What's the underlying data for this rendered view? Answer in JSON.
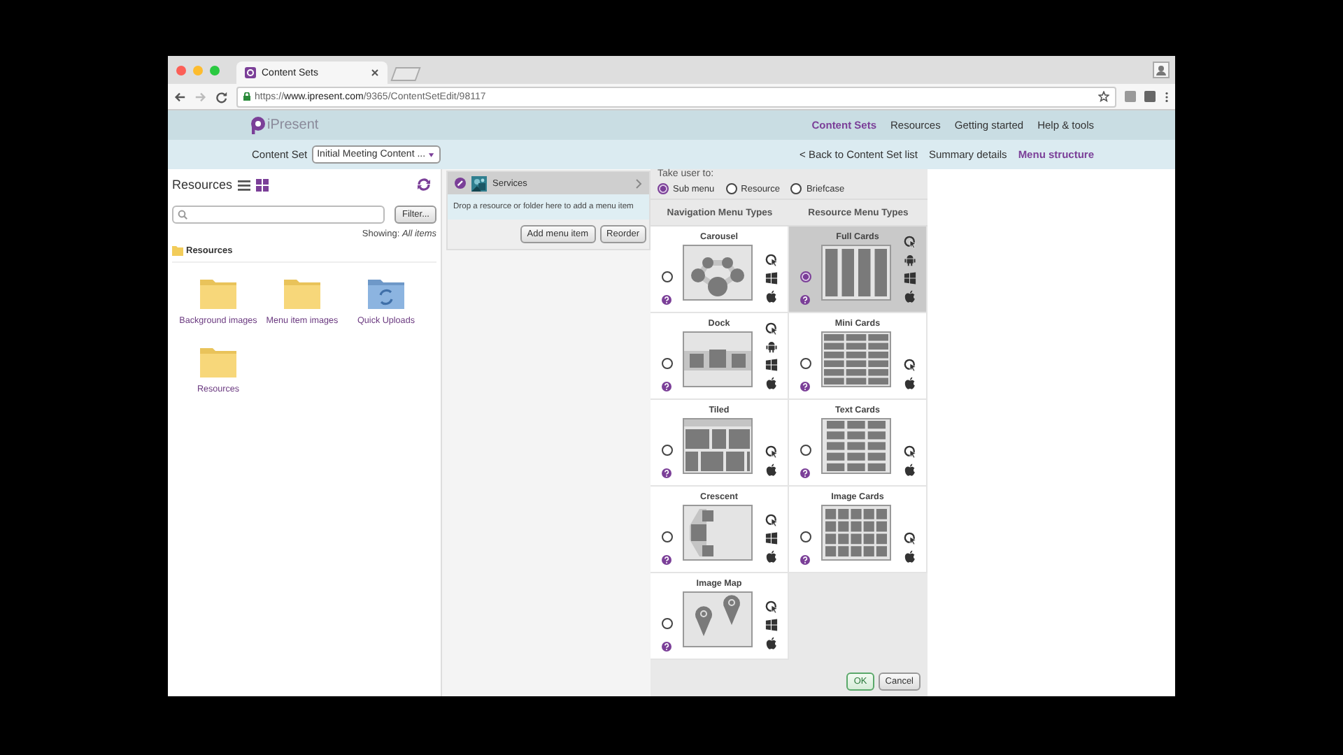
{
  "browser": {
    "tabs": [
      {
        "title": "Content Sets"
      }
    ],
    "url": "https://**www.ipresent.com**/9365/ContentSetEdit/98117"
  },
  "header": {
    "logo": "iPresent",
    "nav": [
      {
        "label": "Content Sets",
        "selected": true
      },
      {
        "label": "Resources",
        "selected": false
      },
      {
        "label": "Getting started",
        "selected": false
      },
      {
        "label": "Help & tools",
        "selected": false
      }
    ]
  },
  "subheader": {
    "label": "Content Set",
    "dropdown": "Initial Meeting Content ...",
    "links": [
      {
        "label": "< Back to Content Set list",
        "selected": false
      },
      {
        "label": "Summary details",
        "selected": false
      },
      {
        "label": "Menu structure",
        "selected": true
      }
    ]
  },
  "resources": {
    "title": "Resources",
    "views": [
      {
        "kind": "list",
        "selected": false
      },
      {
        "kind": "grid",
        "selected": true
      }
    ],
    "filter_button": "Filter...",
    "showing": "Showing: *All items*",
    "breadcrumb": "Resources",
    "items": [
      {
        "name": "Background images",
        "kind": "folder"
      },
      {
        "name": "Menu item images",
        "kind": "folder"
      },
      {
        "name": "Quick Uploads",
        "kind": "uploads"
      },
      {
        "name": "Resources",
        "kind": "folder"
      }
    ]
  },
  "menu": {
    "items": [
      {
        "label": "Services"
      }
    ],
    "drop_hint": "Drop a resource or folder here to add a menu item",
    "buttons": [
      "Add menu item",
      "Reorder"
    ]
  },
  "dialog": {
    "prompt": "Take user to:",
    "targets": [
      {
        "label": "Sub menu",
        "selected": true
      },
      {
        "label": "Resource",
        "selected": false
      },
      {
        "label": "Briefcase",
        "selected": false
      }
    ],
    "columns": [
      {
        "heading": "Navigation Menu Types",
        "types": [
          {
            "name": "Carousel",
            "kind": "carousel",
            "selected": false,
            "platforms": [
              {
                "kind": "web"
              },
              {
                "kind": "windows"
              },
              {
                "kind": "apple"
              }
            ]
          },
          {
            "name": "Dock",
            "kind": "dock",
            "selected": false,
            "platforms": [
              {
                "kind": "web"
              },
              {
                "kind": "android"
              },
              {
                "kind": "windows"
              },
              {
                "kind": "apple"
              }
            ]
          },
          {
            "name": "Tiled",
            "kind": "tiled",
            "selected": false,
            "platforms": [
              {
                "kind": "web"
              },
              {
                "kind": "apple"
              }
            ]
          },
          {
            "name": "Crescent",
            "kind": "crescent",
            "selected": false,
            "platforms": [
              {
                "kind": "web"
              },
              {
                "kind": "windows"
              },
              {
                "kind": "apple"
              }
            ]
          },
          {
            "name": "Image Map",
            "kind": "image_map",
            "selected": false,
            "platforms": [
              {
                "kind": "web"
              },
              {
                "kind": "windows"
              },
              {
                "kind": "apple"
              }
            ]
          }
        ]
      },
      {
        "heading": "Resource Menu Types",
        "types": [
          {
            "name": "Full Cards",
            "kind": "full_cards",
            "selected": true,
            "platforms": [
              {
                "kind": "web"
              },
              {
                "kind": "android"
              },
              {
                "kind": "windows"
              },
              {
                "kind": "apple"
              }
            ]
          },
          {
            "name": "Mini Cards",
            "kind": "mini_cards",
            "selected": false,
            "platforms": [
              {
                "kind": "web"
              },
              {
                "kind": "apple"
              }
            ]
          },
          {
            "name": "Text Cards",
            "kind": "text_cards",
            "selected": false,
            "platforms": [
              {
                "kind": "web"
              },
              {
                "kind": "apple"
              }
            ]
          },
          {
            "name": "Image Cards",
            "kind": "image_cards",
            "selected": false,
            "platforms": [
              {
                "kind": "web"
              },
              {
                "kind": "apple"
              }
            ]
          }
        ]
      }
    ],
    "buttons": [
      {
        "label": "OK",
        "kind": "primary"
      },
      {
        "label": "Cancel",
        "kind": "secondary"
      }
    ]
  }
}
